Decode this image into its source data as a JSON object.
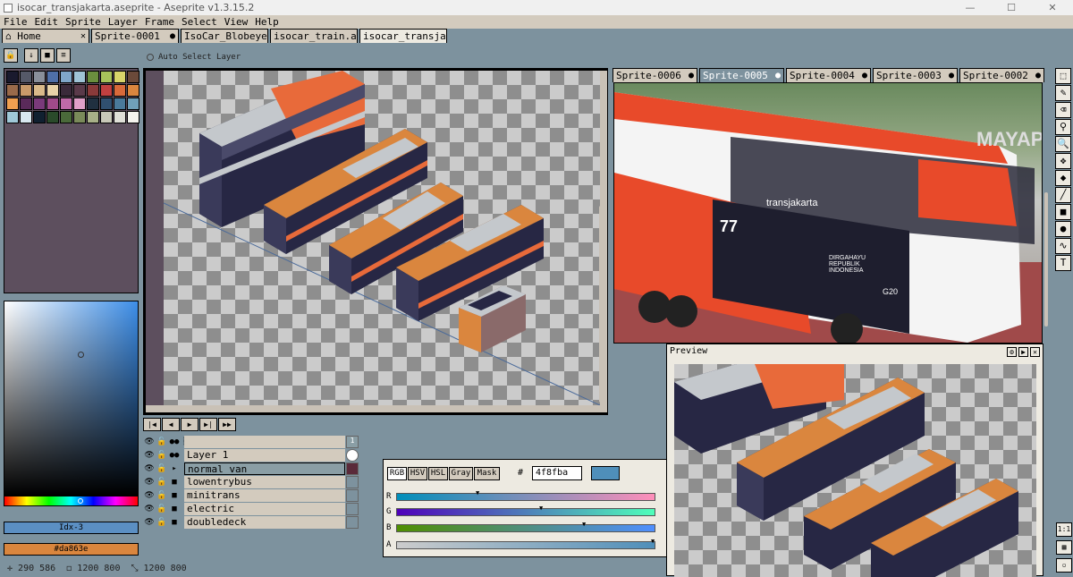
{
  "window": {
    "title": "isocar_transjakarta.aseprite - Aseprite v1.3.15.2",
    "controls": [
      "—",
      "☐",
      "✕"
    ]
  },
  "menu": [
    "File",
    "Edit",
    "Sprite",
    "Layer",
    "Frame",
    "Select",
    "View",
    "Help"
  ],
  "tabs": [
    {
      "label": "Home",
      "close": "✕"
    },
    {
      "label": "Sprite-0001",
      "close": "●"
    },
    {
      "label": "IsoCar_Blobeye",
      "close": "✕"
    },
    {
      "label": "isocar_train.ase",
      "close": "✕"
    },
    {
      "label": "isocar_transjak",
      "close": "✕"
    }
  ],
  "toolbar": {
    "auto_select_label": "Auto Select Layer"
  },
  "palette_colors": [
    "#1a1a2e",
    "#555968",
    "#8a8f9a",
    "#4f6fa8",
    "#7fa7c9",
    "#9fc3d6",
    "#6b8f3e",
    "#a7c25a",
    "#d8d46a",
    "#6b4a3a",
    "#9a6a4a",
    "#c89a6a",
    "#d9b98a",
    "#e8d2a8",
    "#3a2a3a",
    "#5a3a4a",
    "#8a3a3a",
    "#c04040",
    "#d86a3a",
    "#da863e",
    "#f0a050",
    "#5a2a5a",
    "#7a3a7a",
    "#a04a8a",
    "#c06aa8",
    "#e0a0c8",
    "#203040",
    "#305070",
    "#4a7a9a",
    "#70a0b8",
    "#a0c8d8",
    "#d8e8f0",
    "#102030",
    "#2a4a2a",
    "#4a6a3a",
    "#7a8a5a",
    "#a8b088",
    "#c8c8b8",
    "#e0e0d8",
    "#f4f4ee"
  ],
  "color": {
    "index_label": "Idx-3",
    "hex_label": "#da863e",
    "hex_value": "4f8fba",
    "swatch": "#4f8fba",
    "mode_buttons": [
      "RGB",
      "HSV",
      "HSL",
      "Gray",
      "Mask"
    ],
    "hash": "#",
    "sliders": [
      "R",
      "G",
      "B",
      "A"
    ],
    "slider_values": [
      79,
      143,
      186,
      255
    ]
  },
  "status": {
    "coords": "290 586",
    "size1": "1200 800",
    "size2": "1200 800"
  },
  "layers": [
    {
      "name": "",
      "type": "header",
      "frame": "1"
    },
    {
      "name": "Layer 1",
      "type": "layer"
    },
    {
      "name": "normal van",
      "type": "group",
      "selected": true
    },
    {
      "name": "lowentrybus",
      "type": "group"
    },
    {
      "name": "minitrans",
      "type": "group"
    },
    {
      "name": "electric",
      "type": "group"
    },
    {
      "name": "doubledeck",
      "type": "group"
    }
  ],
  "sprite_tabs": [
    {
      "label": "Sprite-0006",
      "close": "●"
    },
    {
      "label": "Sprite-0005",
      "close": "●"
    },
    {
      "label": "Sprite-0004",
      "close": "●"
    },
    {
      "label": "Sprite-0003",
      "close": "●"
    },
    {
      "label": "Sprite-0002",
      "close": "●"
    }
  ],
  "photo": {
    "logo_text": "transjakarta",
    "sign_text": "MAYAP",
    "side_text": "DIRGAHAYU REPUBLIK INDONESIA",
    "event_text": "G20",
    "number_text": "77"
  },
  "preview": {
    "title": "Preview",
    "zoom_label": "1:1"
  },
  "bus_colors": {
    "roof": "#da863e",
    "body": "#272744",
    "light": "#c4c8cc",
    "stripe": "#e86a3a",
    "window": "#4a4a6a"
  }
}
